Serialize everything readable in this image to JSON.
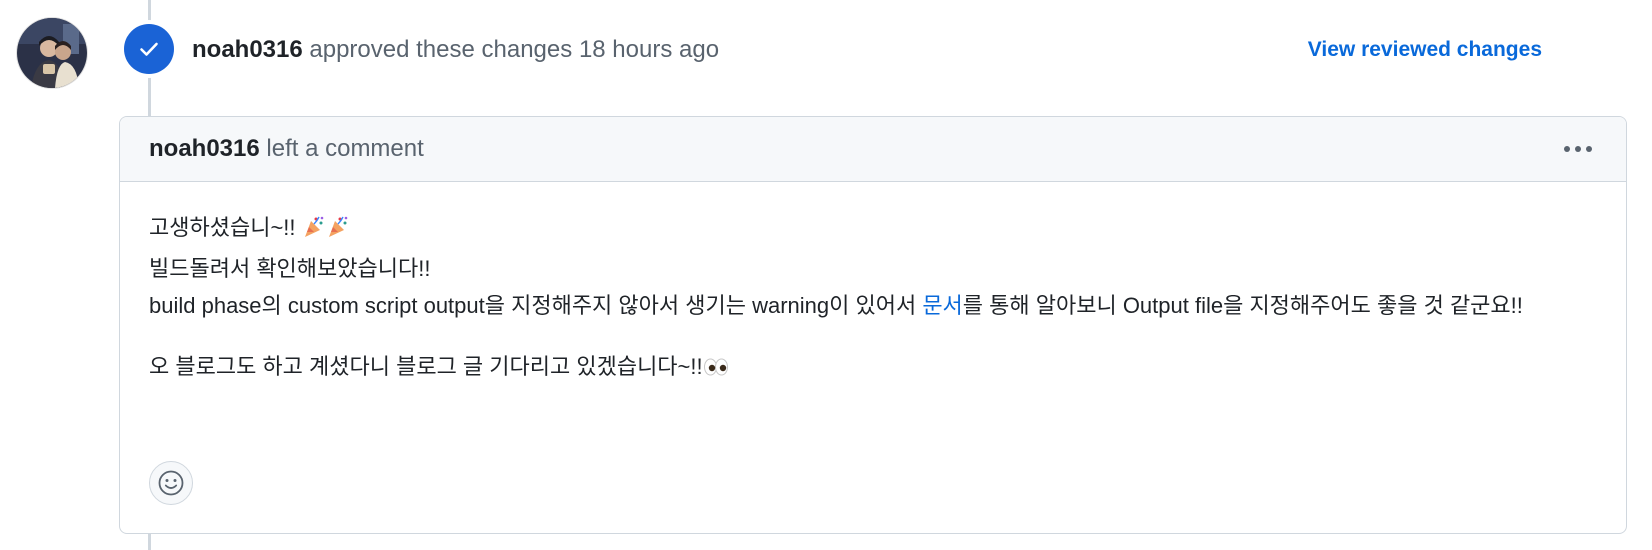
{
  "colors": {
    "accent": "#0969da",
    "approved_badge": "#1a63d6",
    "border": "#d0d7de",
    "header_bg": "#f6f8fa",
    "muted_text": "#59636e",
    "text": "#1f2328"
  },
  "review": {
    "author": "noah0316",
    "action": "approved these changes",
    "time": "18 hours ago",
    "status_icon": "check-icon",
    "view_changes_label": "View reviewed changes"
  },
  "comment": {
    "author": "noah0316",
    "action": "left a comment",
    "menu_icon": "kebab-horizontal-icon",
    "body": {
      "line1": "고생하셨습니~!! ",
      "line1_emoji": "party-popper-icon x2",
      "line2": "빌드돌려서 확인해보았습니다!!",
      "line3_before_link": "build phase의 custom script output을 지정해주지 않아서 생기는 warning이 있어서 ",
      "line3_link": "문서",
      "line3_after_link": "를 통해 알아보니 Output file을 지정해주어도 좋을 것 같군요!!",
      "line4": "오 블로그도 하고 계셨다니 블로그 글 기다리고 있겠습니다~!!",
      "line4_emoji": "eyes-icon"
    },
    "reaction_icon": "smiley-icon"
  }
}
